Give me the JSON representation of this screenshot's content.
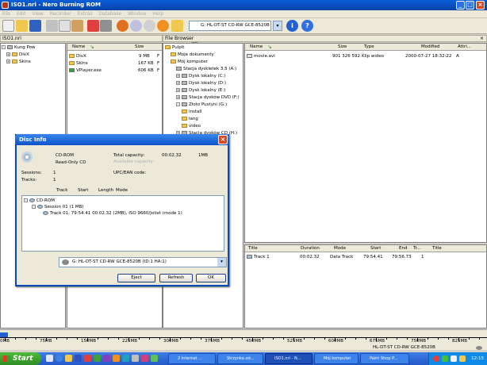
{
  "window": {
    "title": "ISO1.nri - Nero Burning ROM"
  },
  "menu": [
    "File",
    "Edit",
    "View",
    "Recorder",
    "Extras",
    "Database",
    "Window",
    "Help"
  ],
  "toolbar": {
    "drive": "G: HL-DT-ST CD-RW GCE-8520B"
  },
  "left_pane": {
    "title": "ISO1.nri",
    "tree": {
      "root": "Kung Pow",
      "children": [
        "DivX",
        "Skins"
      ]
    },
    "columns": [
      "Name",
      "Size"
    ],
    "files": [
      {
        "name": "DivX",
        "size": "9 MB",
        "flag": "F"
      },
      {
        "name": "Skins",
        "size": "167 KB",
        "flag": "F"
      },
      {
        "name": "VPlayer.exe",
        "size": "606 KB",
        "flag": "F"
      }
    ]
  },
  "file_browser": {
    "title": "File Browser",
    "tree": [
      {
        "label": "Pulpit",
        "level": 0
      },
      {
        "label": "Moje dokumenty",
        "level": 1
      },
      {
        "label": "Mój komputer",
        "level": 1
      },
      {
        "label": "Stacja dyskietek 3,5 (A:)",
        "level": 2
      },
      {
        "label": "Dysk lokalny (C:)",
        "level": 2
      },
      {
        "label": "Dysk lokalny (D:)",
        "level": 2
      },
      {
        "label": "Dysk lokalny (E:)",
        "level": 2
      },
      {
        "label": "Stacja dysków DVD (F:)",
        "level": 2
      },
      {
        "label": "Złoto Pustyni (G:)",
        "level": 2
      },
      {
        "label": "install",
        "level": 3
      },
      {
        "label": "lang",
        "level": 3
      },
      {
        "label": "video",
        "level": 3
      },
      {
        "label": "Stacja dysków CD (H:)",
        "level": 2
      }
    ],
    "columns": [
      "Name",
      "Size",
      "Type",
      "Modified",
      "Attri..."
    ],
    "files": [
      {
        "name": "movie.avi",
        "size": "901 326 592",
        "type": "Klip wideo",
        "modified": "2000-07-27 18:32:22",
        "attr": "A"
      }
    ]
  },
  "tracks": {
    "columns": [
      "Title",
      "Duration",
      "Mode",
      "Start",
      "End",
      "Tr...",
      "Title"
    ],
    "rows": [
      {
        "title": "Track 1",
        "duration": "00:02.32",
        "mode": "Data Track",
        "start": "79:54.41",
        "end": "79:56.73",
        "tr": "1"
      }
    ]
  },
  "dialog": {
    "title": "Disc Info",
    "disc_type": "CD-ROM",
    "disc_subtype": "Read-Only CD",
    "total_capacity_label": "Total capacity:",
    "total_capacity_value": "00:02.32",
    "total_capacity_size": "1MB",
    "available_capacity_label": "Available capacity:",
    "sessions_label": "Sessions:",
    "sessions_value": "1",
    "tracks_label": "Tracks:",
    "tracks_value": "1",
    "upc_label": "UPC/EAN code:",
    "tree_columns": [
      "Track",
      "Start",
      "Length",
      "Mode"
    ],
    "tree": {
      "root": "CD-ROM",
      "session": "Session 01 (1 MB)",
      "track": "Track 01: 79:54.41     00:02.32 (2MB),   ISO 9660/Joliet (mode 1)"
    },
    "drive": "G: HL-DT-ST CD-RW GCE-8520B  (ID:1  HA:1)",
    "buttons": {
      "eject": "Eject",
      "refresh": "Refresh",
      "ok": "OK"
    }
  },
  "scale": {
    "labels": [
      "0MB",
      "75MB",
      "150MB",
      "225MB",
      "300MB",
      "375MB",
      "450MB",
      "525MB",
      "600MB",
      "675MB",
      "750MB",
      "825MB"
    ],
    "status": "HL-DT-ST CD-RW GCE-8520B"
  },
  "taskbar": {
    "start": "Start",
    "tasks": [
      "2 Internet ...",
      "Strzynka od...",
      "ISO1.nri - N...",
      "Mój komputer",
      "Paint Shop P..."
    ],
    "clock": "12:15"
  }
}
